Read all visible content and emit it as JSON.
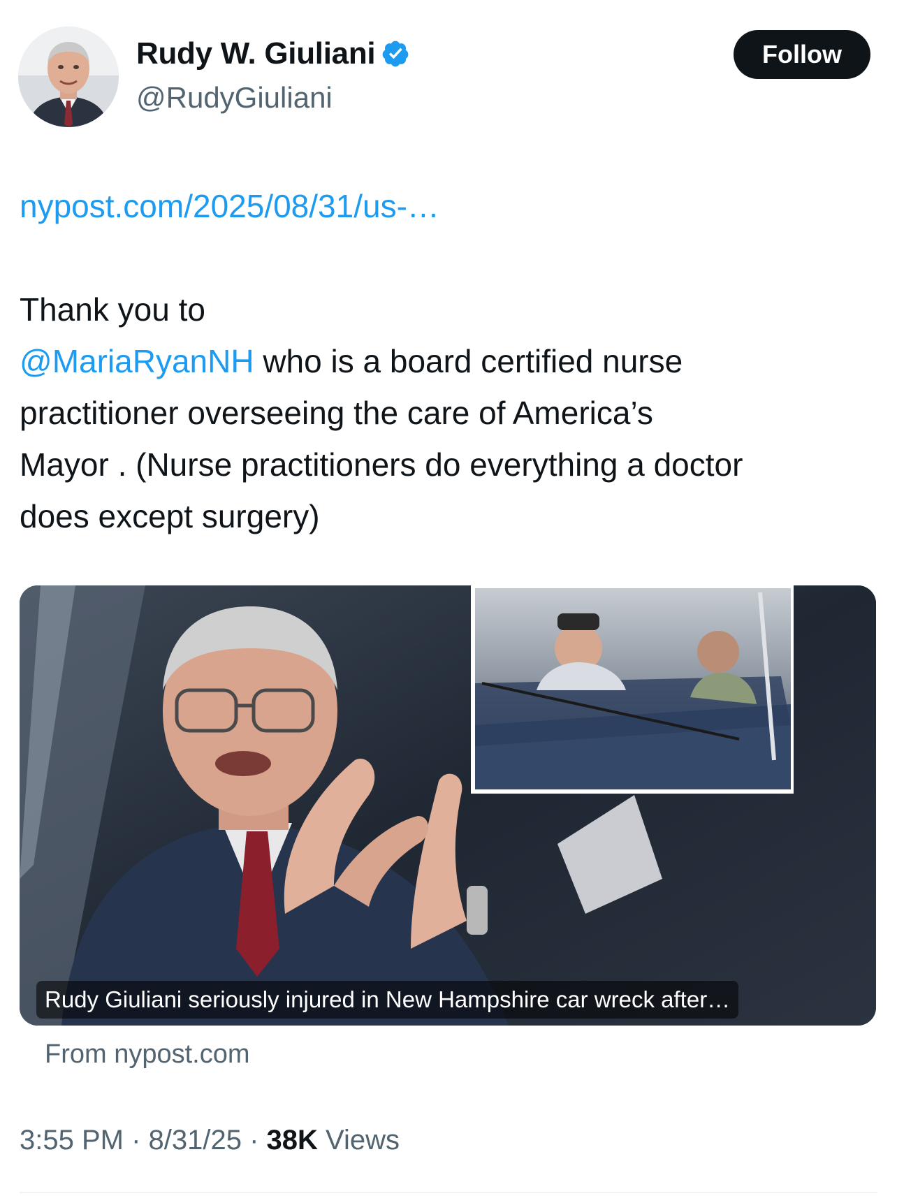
{
  "author": {
    "display_name": "Rudy W. Giuliani",
    "handle": "@RudyGiuliani",
    "verified_icon": "verified-badge-icon",
    "verified_color": "#1d9bf0"
  },
  "follow_button": {
    "label": "Follow"
  },
  "tweet": {
    "link_text": "nypost.com/2025/08/31/us-…",
    "text_line1": "Thank you to",
    "mention": "@MariaRyanNH",
    "text_line2_rest": " who is a board certified nurse",
    "text_line3": "practitioner overseeing the care of America’s",
    "text_line4": "Mayor . (Nurse practitioners do everything a doctor",
    "text_line5": "does except surgery)"
  },
  "link_card": {
    "caption": "Rudy Giuliani seriously injured in New Hampshire car wreck after…",
    "source": "From nypost.com"
  },
  "meta": {
    "time": "3:55 PM",
    "separator": " · ",
    "date": "8/31/25",
    "views_count": "38K",
    "views_label": " Views"
  },
  "colors": {
    "link": "#1d9bf0",
    "text": "#0f1419",
    "secondary": "#536471"
  }
}
